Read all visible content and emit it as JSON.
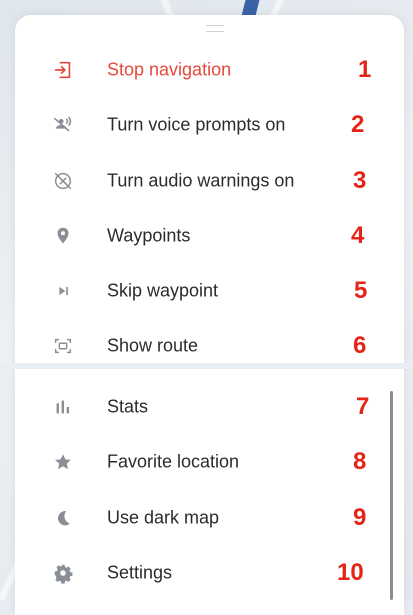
{
  "menu": {
    "items": [
      {
        "label": "Stop navigation",
        "icon": "exit-icon",
        "annotation": "1",
        "color": "#e5483c"
      },
      {
        "label": "Turn voice prompts on",
        "icon": "voice-off-icon",
        "annotation": "2"
      },
      {
        "label": "Turn audio warnings on",
        "icon": "alert-off-icon",
        "annotation": "3"
      },
      {
        "label": "Waypoints",
        "icon": "pin-icon",
        "annotation": "4"
      },
      {
        "label": "Skip waypoint",
        "icon": "skip-icon",
        "annotation": "5"
      },
      {
        "label": "Show route",
        "icon": "route-frame-icon",
        "annotation": "6"
      },
      {
        "label": "Stats",
        "icon": "bar-chart-icon",
        "annotation": "7"
      },
      {
        "label": "Favorite location",
        "icon": "star-icon",
        "annotation": "8"
      },
      {
        "label": "Use dark map",
        "icon": "moon-icon",
        "annotation": "9"
      },
      {
        "label": "Settings",
        "icon": "gear-icon",
        "annotation": "10"
      }
    ]
  },
  "colors": {
    "accent": "#e5483c",
    "annotation": "#e32416",
    "icon": "#8a8f96",
    "text": "#2b2b2b"
  }
}
